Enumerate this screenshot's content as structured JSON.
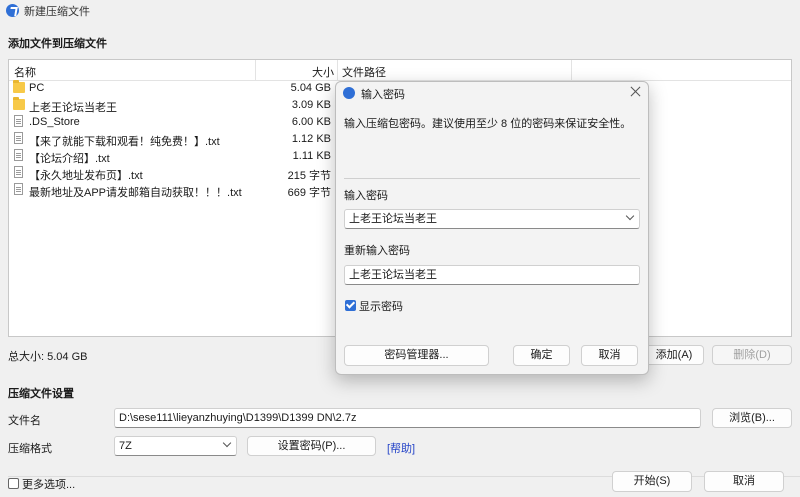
{
  "window": {
    "title": "新建压缩文件"
  },
  "add_files_label": "添加文件到压缩文件",
  "file_list": {
    "columns": {
      "name": "名称",
      "size": "大小",
      "path": "文件路径"
    },
    "rows": [
      {
        "name": "PC",
        "size": "5.04 GB",
        "icon": "folder-icon"
      },
      {
        "name": "上老王论坛当老王",
        "size": "3.09 KB",
        "icon": "folder-icon"
      },
      {
        "name": ".DS_Store",
        "size": "6.00 KB",
        "icon": "file-icon"
      },
      {
        "name": "【来了就能下载和观看！纯免费！】.txt",
        "size": "1.12 KB",
        "icon": "text-file-icon"
      },
      {
        "name": "【论坛介绍】.txt",
        "size": "1.11 KB",
        "icon": "text-file-icon"
      },
      {
        "name": "【永久地址发布页】.txt",
        "size": "215 字节",
        "icon": "text-file-icon"
      },
      {
        "name": "最新地址及APP请发邮箱自动获取！！！.txt",
        "size": "669 字节",
        "icon": "text-file-icon"
      }
    ]
  },
  "total_size": "总大小: 5.04 GB",
  "add_button": "添加(A)",
  "delete_button": "删除(D)",
  "settings": {
    "section_label": "压缩文件设置",
    "filename_label": "文件名",
    "filename_value": "D:\\sese111\\lieyanzhuying\\D1399\\D1399 DN\\2.7z",
    "browse_button": "浏览(B)...",
    "format_label": "压缩格式",
    "format_value": "7Z",
    "set_password_button": "设置密码(P)...",
    "help_link": "[帮助]"
  },
  "more_options": "更多选项...",
  "start_button": "开始(S)",
  "cancel_button": "取消",
  "password_dialog": {
    "title": "输入密码",
    "description": "输入压缩包密码。建议使用至少 8 位的密码来保证安全性。",
    "password_label": "输入密码",
    "password_value": "上老王论坛当老王",
    "confirm_label": "重新输入密码",
    "confirm_value": "上老王论坛当老王",
    "show_password_label": "显示密码",
    "show_password_checked": true,
    "manager_button": "密码管理器...",
    "ok_button": "确定",
    "cancel_button": "取消"
  },
  "colors": {
    "accent": "#2f6fd6",
    "folder": "#f7c948",
    "link": "#2645c8"
  }
}
